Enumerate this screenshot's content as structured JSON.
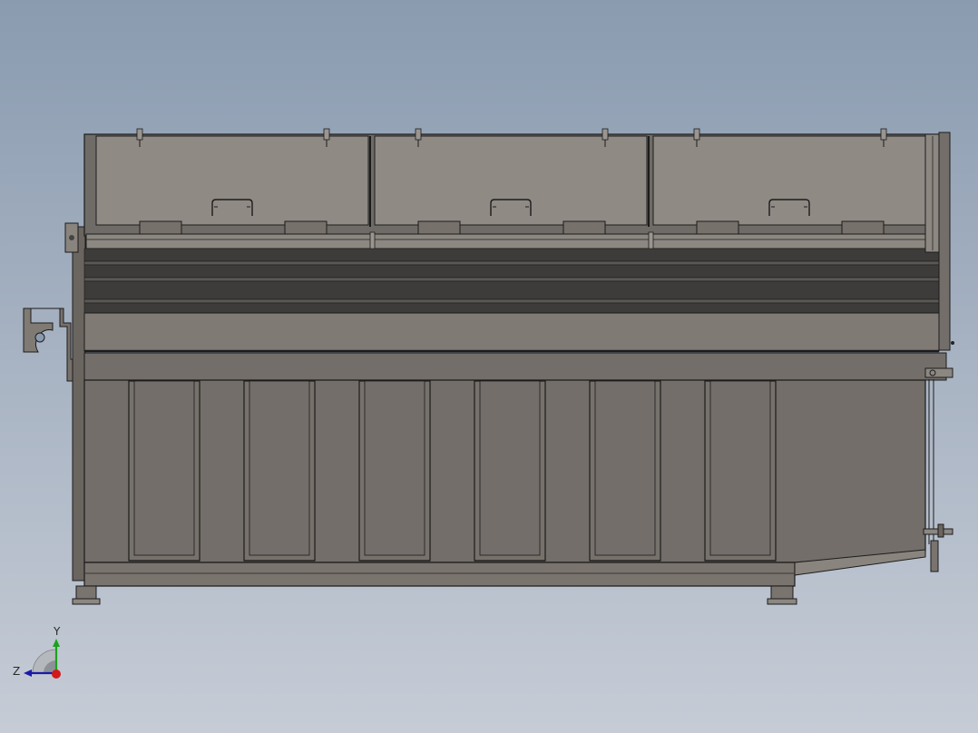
{
  "viewport": {
    "background_top": "#8a9bb0",
    "background_bottom": "#c6ccd6"
  },
  "model": {
    "view": "side",
    "colors": {
      "lid": "#8f8a84",
      "lid_dark": "#6f6b66",
      "body": "#736e69",
      "body_light": "#807a74",
      "stripe_dark": "#3e3c3a",
      "stripe_mid": "#5a5754",
      "edge": "#1c1c1c",
      "panel": "#77716b"
    },
    "lids": [
      {
        "handle_icon": "lid-handle-icon"
      },
      {
        "handle_icon": "lid-handle-icon"
      },
      {
        "handle_icon": "lid-handle-icon"
      }
    ],
    "side_panels": 6
  },
  "triad": {
    "y_label": "Y",
    "z_label": "Z",
    "colors": {
      "y": "#1aa31a",
      "z": "#1a1aa8",
      "x": "#d11a1a"
    }
  }
}
